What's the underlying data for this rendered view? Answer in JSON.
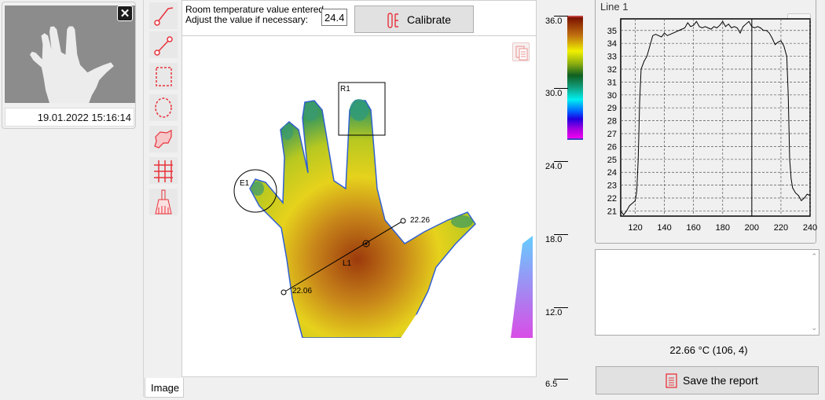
{
  "thumbnail": {
    "timestamp": "19.01.2022 15:16:14",
    "close_icon": "close-icon"
  },
  "toolbar": {
    "tools": [
      {
        "name": "polyline-tool",
        "icon": "polyline-icon"
      },
      {
        "name": "line-tool",
        "icon": "line-icon"
      },
      {
        "name": "rectangle-tool",
        "icon": "dashed-rectangle-icon"
      },
      {
        "name": "ellipse-tool",
        "icon": "dashed-ellipse-icon"
      },
      {
        "name": "freeform-tool",
        "icon": "freeform-area-icon"
      },
      {
        "name": "grid-tool",
        "icon": "grid-icon"
      },
      {
        "name": "clear-tool",
        "icon": "broom-icon"
      }
    ],
    "accent": "#e8323c"
  },
  "calibration": {
    "message_line1": "Room temperature value entered.",
    "message_line2": "Adjust the value if necessary:",
    "room_temperature": "24.4",
    "calibrate_label": "Calibrate"
  },
  "image": {
    "regions": {
      "rect": "R1",
      "ellipse": "E1",
      "line": "L1"
    },
    "line_start_value": "22.06",
    "line_end_value": "22.26"
  },
  "tabs": [
    {
      "label": "Image",
      "active": true
    }
  ],
  "scale": {
    "labels": [
      "36.0",
      "30.0",
      "24.0",
      "18.0",
      "12.0",
      "6.5"
    ],
    "palette_max": "36.0",
    "palette_min": "26.5"
  },
  "profile": {
    "title": "Line 1",
    "histogram_icon": "histogram-icon"
  },
  "chart_data": {
    "type": "line",
    "title": "Line 1",
    "xlim": [
      110,
      240
    ],
    "ylim": [
      20.6,
      35.9
    ],
    "xticks": [
      120,
      140,
      160,
      180,
      200,
      220,
      240
    ],
    "yticks": [
      21,
      22,
      23,
      24,
      25,
      26,
      27,
      28,
      29,
      30,
      31,
      32,
      33,
      34,
      35
    ],
    "grid": true,
    "marker_x": 200,
    "x": [
      110,
      112,
      114,
      116,
      118,
      120,
      121,
      122,
      123,
      124,
      126,
      128,
      130,
      132,
      134,
      136,
      138,
      140,
      142,
      144,
      146,
      148,
      150,
      152,
      154,
      156,
      158,
      160,
      162,
      164,
      166,
      168,
      170,
      172,
      174,
      176,
      178,
      180,
      182,
      184,
      186,
      188,
      190,
      192,
      194,
      196,
      198,
      200,
      202,
      204,
      206,
      208,
      210,
      212,
      214,
      216,
      218,
      220,
      222,
      224,
      225,
      226,
      227,
      228,
      230,
      232,
      234,
      236,
      238,
      240
    ],
    "y": [
      21.0,
      20.7,
      21.0,
      21.4,
      21.6,
      21.8,
      22.5,
      25.0,
      29.5,
      32.0,
      32.6,
      33.0,
      33.8,
      34.6,
      34.7,
      34.6,
      34.5,
      34.8,
      34.6,
      34.7,
      34.8,
      34.9,
      35.0,
      35.1,
      35.2,
      35.6,
      35.3,
      35.4,
      35.7,
      35.3,
      35.2,
      35.3,
      35.2,
      35.1,
      35.3,
      35.2,
      35.4,
      35.7,
      35.3,
      35.5,
      35.2,
      35.3,
      35.2,
      34.8,
      35.3,
      35.5,
      35.7,
      35.3,
      35.2,
      35.3,
      35.2,
      35.0,
      35.0,
      34.8,
      34.4,
      33.9,
      34.1,
      34.2,
      33.8,
      33.0,
      30.0,
      25.0,
      23.5,
      22.8,
      22.4,
      22.2,
      21.8,
      22.0,
      22.3,
      22.2
    ]
  },
  "status": {
    "readout": "22.66 °C (106, 4)"
  },
  "report": {
    "save_label": "Save the report"
  }
}
